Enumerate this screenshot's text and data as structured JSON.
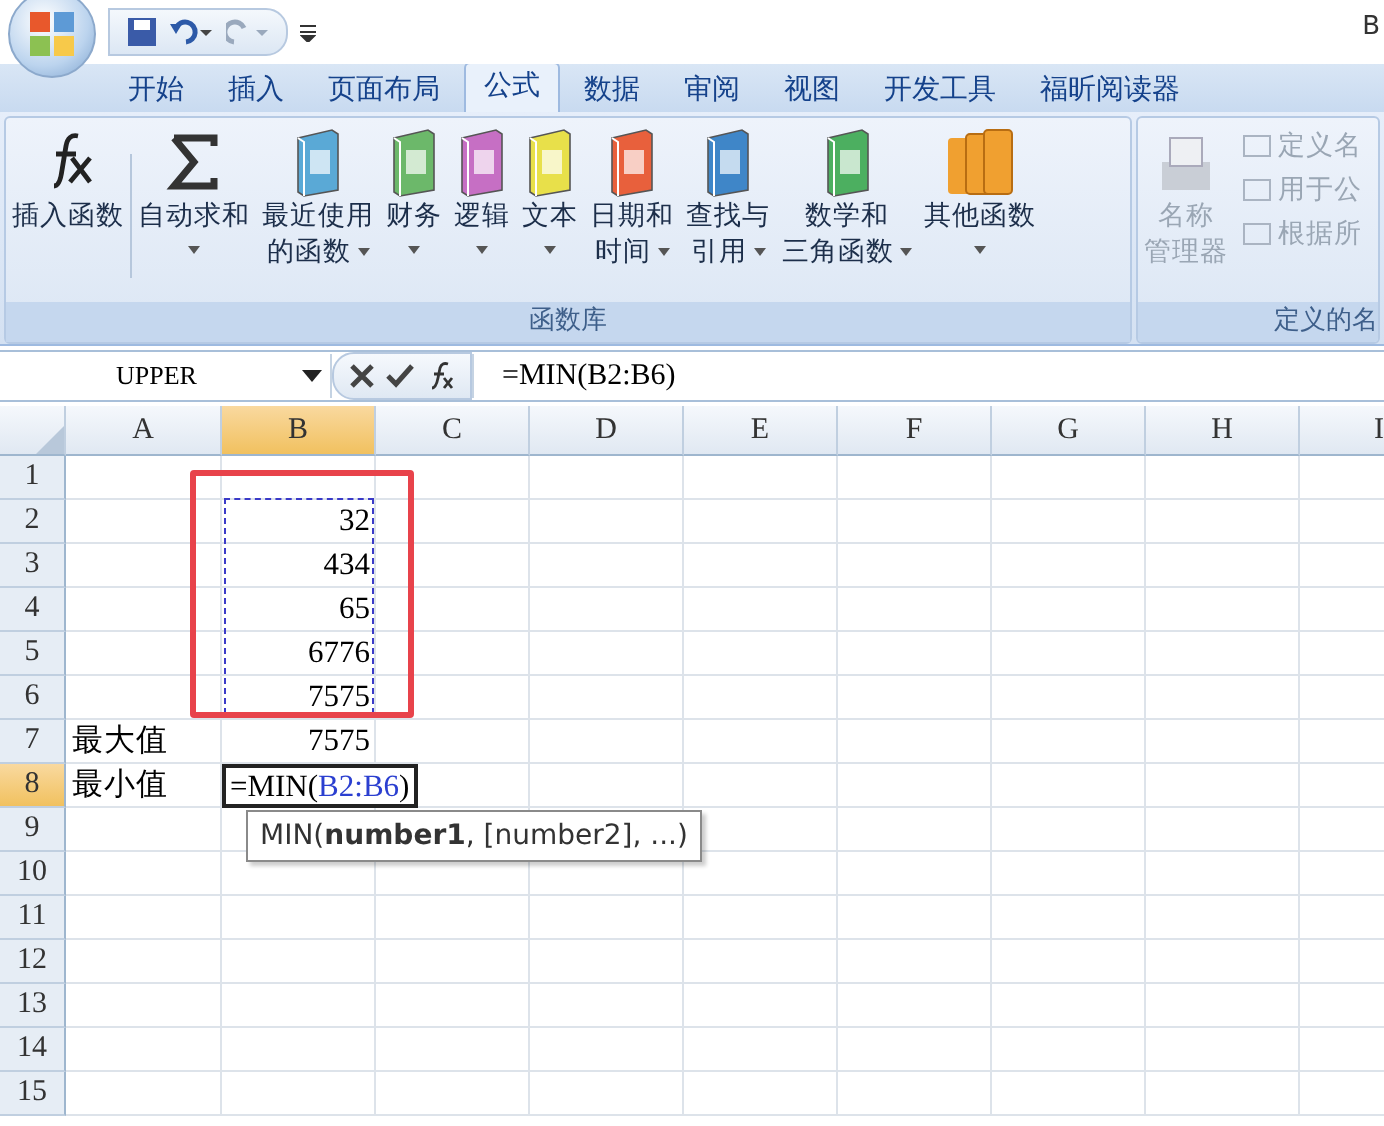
{
  "quick_access": {
    "title_fragment": "B"
  },
  "tabs": [
    {
      "label": "开始",
      "selected": false
    },
    {
      "label": "插入",
      "selected": false
    },
    {
      "label": "页面布局",
      "selected": false
    },
    {
      "label": "公式",
      "selected": true
    },
    {
      "label": "数据",
      "selected": false
    },
    {
      "label": "审阅",
      "selected": false
    },
    {
      "label": "视图",
      "selected": false
    },
    {
      "label": "开发工具",
      "selected": false
    },
    {
      "label": "福昕阅读器",
      "selected": false
    }
  ],
  "ribbon": {
    "groups": [
      {
        "label": "函数库",
        "buttons": [
          {
            "kind": "fx",
            "lines": [
              "插入函数"
            ],
            "dropdown": false
          },
          {
            "kind": "sigma",
            "lines": [
              "自动求和"
            ],
            "dropdown": true
          },
          {
            "kind": "book",
            "color": "#5aa9d6",
            "lines": [
              "最近使用",
              "的函数"
            ],
            "dropdown": true
          },
          {
            "kind": "book",
            "color": "#6cb86a",
            "lines": [
              "财务"
            ],
            "dropdown": true
          },
          {
            "kind": "book",
            "color": "#c66fc4",
            "lines": [
              "逻辑"
            ],
            "dropdown": true
          },
          {
            "kind": "book",
            "color": "#e8e04a",
            "lines": [
              "文本"
            ],
            "dropdown": true
          },
          {
            "kind": "book",
            "color": "#e8603c",
            "lines": [
              "日期和",
              "时间"
            ],
            "dropdown": true
          },
          {
            "kind": "book",
            "color": "#3f86c8",
            "lines": [
              "查找与",
              "引用"
            ],
            "dropdown": true
          },
          {
            "kind": "book",
            "color": "#4caf60",
            "lines": [
              "数学和",
              "三角函数"
            ],
            "dropdown": true
          },
          {
            "kind": "books",
            "color": "#f0a030",
            "lines": [
              "其他函数"
            ],
            "dropdown": true
          }
        ]
      },
      {
        "label": "定义的名",
        "manager": {
          "lines": [
            "名称",
            "管理器"
          ],
          "disabled": true
        },
        "small": [
          {
            "label": "定义名",
            "disabled": true
          },
          {
            "label": "用于公",
            "disabled": true
          },
          {
            "label": "根据所",
            "disabled": true
          }
        ]
      }
    ]
  },
  "formula_bar": {
    "name_box": "UPPER",
    "formula": "=MIN(B2:B6)"
  },
  "columns": [
    {
      "label": "A",
      "selected": false
    },
    {
      "label": "B",
      "selected": true
    },
    {
      "label": "C",
      "selected": false
    },
    {
      "label": "D",
      "selected": false
    },
    {
      "label": "E",
      "selected": false
    },
    {
      "label": "F",
      "selected": false
    },
    {
      "label": "G",
      "selected": false
    },
    {
      "label": "H",
      "selected": false
    },
    {
      "label": "I",
      "selected": false
    }
  ],
  "rows": [
    {
      "label": "1",
      "selected": false
    },
    {
      "label": "2",
      "selected": false,
      "b": "32"
    },
    {
      "label": "3",
      "selected": false,
      "b": "434"
    },
    {
      "label": "4",
      "selected": false,
      "b": "65"
    },
    {
      "label": "5",
      "selected": false,
      "b": "6776"
    },
    {
      "label": "6",
      "selected": false,
      "b": "7575"
    },
    {
      "label": "7",
      "selected": false,
      "a": "最大值",
      "b": "7575"
    },
    {
      "label": "8",
      "selected": true,
      "a": "最小值",
      "editing": true,
      "formula_parts": [
        {
          "kind": "plain",
          "text": "=MIN("
        },
        {
          "kind": "ref",
          "text": "B2:B6"
        },
        {
          "kind": "plain",
          "text": ")"
        }
      ]
    },
    {
      "label": "9",
      "selected": false
    },
    {
      "label": "10",
      "selected": false
    },
    {
      "label": "11",
      "selected": false
    },
    {
      "label": "12",
      "selected": false
    },
    {
      "label": "13",
      "selected": false
    },
    {
      "label": "14",
      "selected": false
    },
    {
      "label": "15",
      "selected": false
    }
  ],
  "tooltip": "MIN(**number1**, [number2], ...)"
}
